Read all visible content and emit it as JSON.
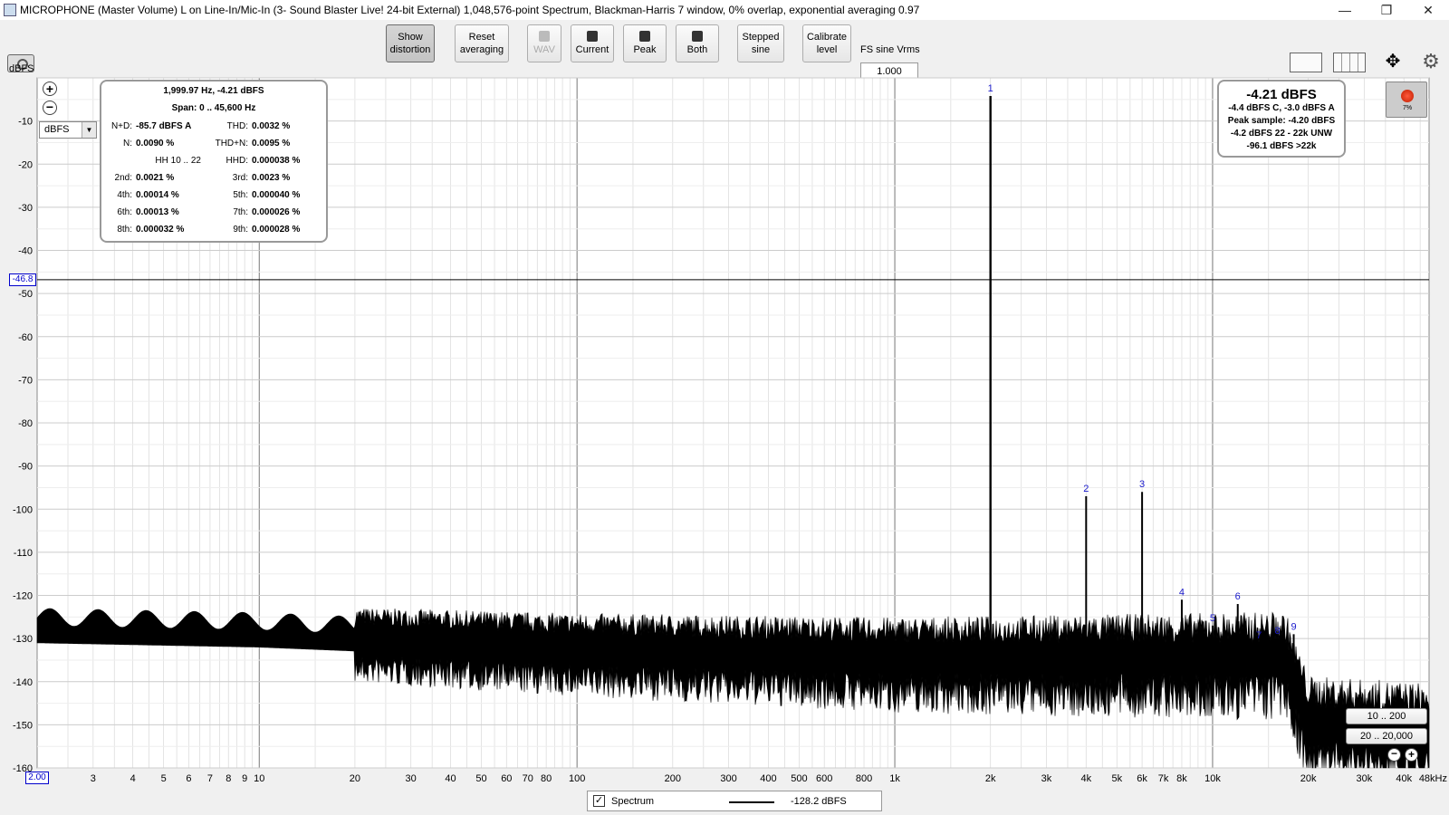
{
  "window": {
    "title": "MICROPHONE (Master Volume) L on Line-In/Mic-In (3- Sound Blaster Live! 24-bit External) 1,048,576-point Spectrum, Blackman-Harris 7 window, 0% overlap, exponential averaging 0.97",
    "minimize": "—",
    "maximize": "❐",
    "close": "✕"
  },
  "toolbar": {
    "show_distortion": [
      "Show",
      "distortion"
    ],
    "reset_averaging": [
      "Reset",
      "averaging"
    ],
    "wav": "WAV",
    "current": "Current",
    "peak": "Peak",
    "both": "Both",
    "stepped_sine": [
      "Stepped",
      "sine"
    ],
    "calibrate_level": [
      "Calibrate",
      "level"
    ],
    "fs_label": "FS sine Vrms",
    "fs_value": "1.000"
  },
  "icons": {
    "move": "✥",
    "gear": "⚙"
  },
  "distortion_panel": {
    "header": "1,999.97 Hz, -4.21 dBFS",
    "span": "Span: 0 .. 45,600 Hz",
    "rows": [
      {
        "l1": "N+D:",
        "v1": "-85.7 dBFS A",
        "l2": "THD:",
        "v2": "0.0032 %"
      },
      {
        "l1": "N:",
        "v1": "0.0090 %",
        "l2": "THD+N:",
        "v2": "0.0095 %"
      },
      {
        "l1": "HH 10 .. 22",
        "v1": "",
        "l2": "HHD:",
        "v2": "0.000038 %"
      },
      {
        "l1": "2nd:",
        "v1": "0.0021 %",
        "l2": "3rd:",
        "v2": "0.0023 %"
      },
      {
        "l1": "4th:",
        "v1": "0.00014 %",
        "l2": "5th:",
        "v2": "0.000040 %"
      },
      {
        "l1": "6th:",
        "v1": "0.00013 %",
        "l2": "7th:",
        "v2": "0.000026 %"
      },
      {
        "l1": "8th:",
        "v1": "0.000032 %",
        "l2": "9th:",
        "v2": "0.000028 %"
      }
    ]
  },
  "level_panel": {
    "main": "-4.21 dBFS",
    "lines": [
      "-4.4 dBFS C, -3.0 dBFS A",
      "Peak sample: -4.20 dBFS",
      "-4.2 dBFS 22 - 22k UNW",
      "-96.1 dBFS >22k"
    ]
  },
  "record": {
    "percent": "7%"
  },
  "unit_select": "dBFS",
  "y_unit_label": "dBFS",
  "cursor_label": "-46.8",
  "x_start_label": "2.00",
  "range_buttons": [
    "10 .. 200",
    "20 .. 20,000"
  ],
  "legend": {
    "checked": "✓",
    "name": "Spectrum",
    "value": "-128.2 dBFS"
  },
  "chart_data": {
    "type": "line",
    "x_scale": "log",
    "xlim": [
      2,
      48000
    ],
    "ylim": [
      -160,
      0
    ],
    "ylabel": "dBFS",
    "grid": true,
    "cursor_y": -46.8,
    "y_ticks": [
      -10,
      -20,
      -30,
      -40,
      -50,
      -60,
      -70,
      -80,
      -90,
      -100,
      -110,
      -120,
      -130,
      -140,
      -150,
      -160
    ],
    "x_ticks": [
      {
        "v": 3,
        "label": "3"
      },
      {
        "v": 4,
        "label": "4"
      },
      {
        "v": 5,
        "label": "5"
      },
      {
        "v": 6,
        "label": "6"
      },
      {
        "v": 7,
        "label": "7"
      },
      {
        "v": 8,
        "label": "8"
      },
      {
        "v": 9,
        "label": "9"
      },
      {
        "v": 10,
        "label": "10"
      },
      {
        "v": 20,
        "label": "20"
      },
      {
        "v": 30,
        "label": "30"
      },
      {
        "v": 40,
        "label": "40"
      },
      {
        "v": 50,
        "label": "50"
      },
      {
        "v": 60,
        "label": "60"
      },
      {
        "v": 70,
        "label": "70"
      },
      {
        "v": 80,
        "label": "80"
      },
      {
        "v": 100,
        "label": "100"
      },
      {
        "v": 200,
        "label": "200"
      },
      {
        "v": 300,
        "label": "300"
      },
      {
        "v": 400,
        "label": "400"
      },
      {
        "v": 500,
        "label": "500"
      },
      {
        "v": 600,
        "label": "600"
      },
      {
        "v": 800,
        "label": "800"
      },
      {
        "v": 1000,
        "label": "1k"
      },
      {
        "v": 2000,
        "label": "2k"
      },
      {
        "v": 3000,
        "label": "3k"
      },
      {
        "v": 4000,
        "label": "4k"
      },
      {
        "v": 5000,
        "label": "5k"
      },
      {
        "v": 6000,
        "label": "6k"
      },
      {
        "v": 7000,
        "label": "7k"
      },
      {
        "v": 8000,
        "label": "8k"
      },
      {
        "v": 10000,
        "label": "10k"
      },
      {
        "v": 20000,
        "label": "20k"
      },
      {
        "v": 30000,
        "label": "30k"
      },
      {
        "v": 40000,
        "label": "40k"
      },
      {
        "v": 48000,
        "label": "48kHz"
      }
    ],
    "series": [
      {
        "name": "Spectrum",
        "color": "#000000",
        "floor": [
          {
            "f": 2,
            "db": -129
          },
          {
            "f": 10,
            "db": -130
          },
          {
            "f": 100,
            "db": -133
          },
          {
            "f": 1000,
            "db": -135
          },
          {
            "f": 1900,
            "db": -135
          },
          {
            "f": 2100,
            "db": -135
          },
          {
            "f": 10000,
            "db": -135
          },
          {
            "f": 17000,
            "db": -135
          },
          {
            "f": 20000,
            "db": -150
          },
          {
            "f": 48000,
            "db": -152
          }
        ]
      }
    ],
    "harmonics": [
      {
        "n": "1",
        "f": 2000,
        "db": -4.2
      },
      {
        "n": "2",
        "f": 4000,
        "db": -97
      },
      {
        "n": "3",
        "f": 6000,
        "db": -96
      },
      {
        "n": "4",
        "f": 8000,
        "db": -121
      },
      {
        "n": "5",
        "f": 10000,
        "db": -127
      },
      {
        "n": "6",
        "f": 12000,
        "db": -122
      },
      {
        "n": "7",
        "f": 14000,
        "db": -131
      },
      {
        "n": "8",
        "f": 16000,
        "db": -130
      },
      {
        "n": "9",
        "f": 18000,
        "db": -129
      }
    ]
  }
}
